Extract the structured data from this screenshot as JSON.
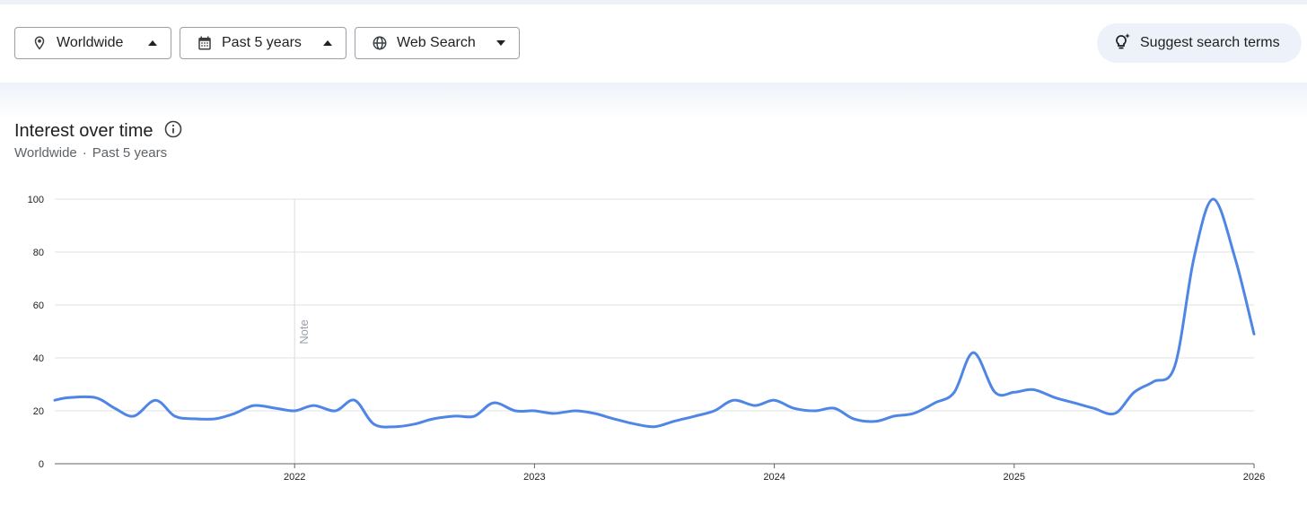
{
  "filters": {
    "region": {
      "label": "Worldwide",
      "icon": "location-pin-icon"
    },
    "time": {
      "label": "Past 5 years",
      "icon": "calendar-icon"
    },
    "property": {
      "label": "Web Search",
      "icon": "globe-icon"
    }
  },
  "suggest": {
    "label": "Suggest search terms",
    "icon": "lightbulb-sparkle-icon"
  },
  "section": {
    "title": "Interest over time",
    "subtitle_region": "Worldwide",
    "subtitle_separator": "·",
    "subtitle_time": "Past 5 years"
  },
  "colors": {
    "line": "#4f86e6",
    "grid": "#e0e0e0",
    "chip_border": "#9aa0a6",
    "suggest_bg": "#edf2fa"
  },
  "chart_data": {
    "type": "line",
    "title": "",
    "xlabel": "",
    "ylabel": "",
    "ylim": [
      0,
      100
    ],
    "yticks": [
      0,
      20,
      40,
      60,
      80,
      100
    ],
    "xlim": [
      2021.0,
      2026.0
    ],
    "xticks": [
      {
        "value": 2022,
        "label": "2022"
      },
      {
        "value": 2023,
        "label": "2023"
      },
      {
        "value": 2024,
        "label": "2024"
      },
      {
        "value": 2025,
        "label": "2025"
      },
      {
        "value": 2026,
        "label": "2026"
      }
    ],
    "annotations": [
      {
        "x": 2022.0,
        "text": "Note"
      }
    ],
    "grid": true,
    "series": [
      {
        "points": [
          [
            2021.0,
            24
          ],
          [
            2021.06,
            25
          ],
          [
            2021.17,
            25
          ],
          [
            2021.25,
            21
          ],
          [
            2021.33,
            18
          ],
          [
            2021.42,
            24
          ],
          [
            2021.5,
            18
          ],
          [
            2021.58,
            17
          ],
          [
            2021.67,
            17
          ],
          [
            2021.75,
            19
          ],
          [
            2021.83,
            22
          ],
          [
            2021.92,
            21
          ],
          [
            2022.0,
            20
          ],
          [
            2022.08,
            22
          ],
          [
            2022.17,
            20
          ],
          [
            2022.25,
            24
          ],
          [
            2022.33,
            15
          ],
          [
            2022.42,
            14
          ],
          [
            2022.5,
            15
          ],
          [
            2022.58,
            17
          ],
          [
            2022.67,
            18
          ],
          [
            2022.75,
            18
          ],
          [
            2022.83,
            23
          ],
          [
            2022.92,
            20
          ],
          [
            2023.0,
            20
          ],
          [
            2023.08,
            19
          ],
          [
            2023.17,
            20
          ],
          [
            2023.25,
            19
          ],
          [
            2023.33,
            17
          ],
          [
            2023.42,
            15
          ],
          [
            2023.5,
            14
          ],
          [
            2023.58,
            16
          ],
          [
            2023.67,
            18
          ],
          [
            2023.75,
            20
          ],
          [
            2023.83,
            24
          ],
          [
            2023.92,
            22
          ],
          [
            2024.0,
            24
          ],
          [
            2024.08,
            21
          ],
          [
            2024.17,
            20
          ],
          [
            2024.25,
            21
          ],
          [
            2024.33,
            17
          ],
          [
            2024.42,
            16
          ],
          [
            2024.5,
            18
          ],
          [
            2024.58,
            19
          ],
          [
            2024.67,
            23
          ],
          [
            2024.75,
            27
          ],
          [
            2024.83,
            42
          ],
          [
            2024.92,
            27
          ],
          [
            2025.0,
            27
          ],
          [
            2025.08,
            28
          ],
          [
            2025.17,
            25
          ],
          [
            2025.25,
            23
          ],
          [
            2025.33,
            21
          ],
          [
            2025.42,
            19
          ],
          [
            2025.5,
            27
          ],
          [
            2025.58,
            31
          ],
          [
            2025.67,
            37
          ],
          [
            2025.75,
            78
          ],
          [
            2025.83,
            100
          ],
          [
            2025.92,
            78
          ],
          [
            2026.0,
            49
          ]
        ]
      }
    ]
  }
}
